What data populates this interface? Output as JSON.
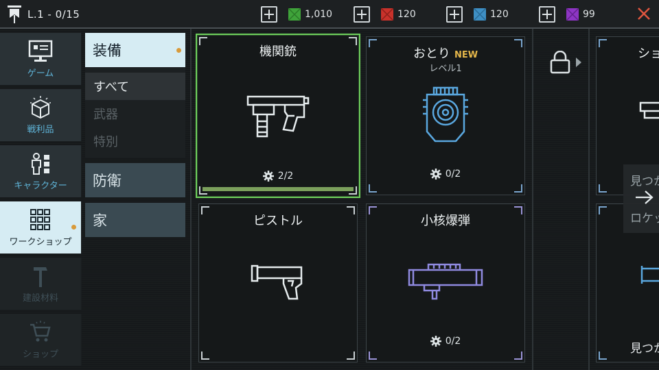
{
  "topbar": {
    "level_text": "L.1 - 0/15",
    "resources": [
      {
        "name": "green",
        "color": "#3fa33a",
        "amount": "1,010"
      },
      {
        "name": "red",
        "color": "#c8322b",
        "amount": "120"
      },
      {
        "name": "blue",
        "color": "#3e8fc4",
        "amount": "120"
      },
      {
        "name": "purple",
        "color": "#8e35c4",
        "amount": "99"
      }
    ],
    "close_icon": "close-icon"
  },
  "sidebar": {
    "items": [
      {
        "label": "ゲーム",
        "icon": "monitor-icon",
        "state": "normal"
      },
      {
        "label": "戦利品",
        "icon": "loot-box-icon",
        "state": "normal"
      },
      {
        "label": "キャラクター",
        "icon": "character-icon",
        "state": "normal"
      },
      {
        "label": "ワークショップ",
        "icon": "grid-icon",
        "state": "active"
      },
      {
        "label": "建設材料",
        "icon": "hammer-icon",
        "state": "disabled"
      },
      {
        "label": "ショップ",
        "icon": "cart-icon",
        "state": "disabled"
      }
    ]
  },
  "categories": {
    "equipment": "装備",
    "sub": [
      "すべて",
      "武器",
      "特別"
    ],
    "defense": "防衛",
    "house": "家"
  },
  "cards": [
    {
      "title": "機関銃",
      "count": "2/2",
      "progress": 1.0,
      "selected": true
    },
    {
      "title": "おとり",
      "badge": "NEW",
      "level": "レベル1",
      "count": "0/2"
    },
    {
      "title": "ピストル"
    },
    {
      "title": "小核爆弾",
      "count": "0/2"
    }
  ],
  "edge": {
    "top_title": "ショ",
    "popup_line1": "見つか",
    "popup_line2": "ロケッ",
    "bottom_text": "見つか"
  },
  "colors": {
    "accent_active": "#d6ecf3",
    "selected_border": "#6fd05c",
    "notify_dot": "#d89a3a"
  }
}
